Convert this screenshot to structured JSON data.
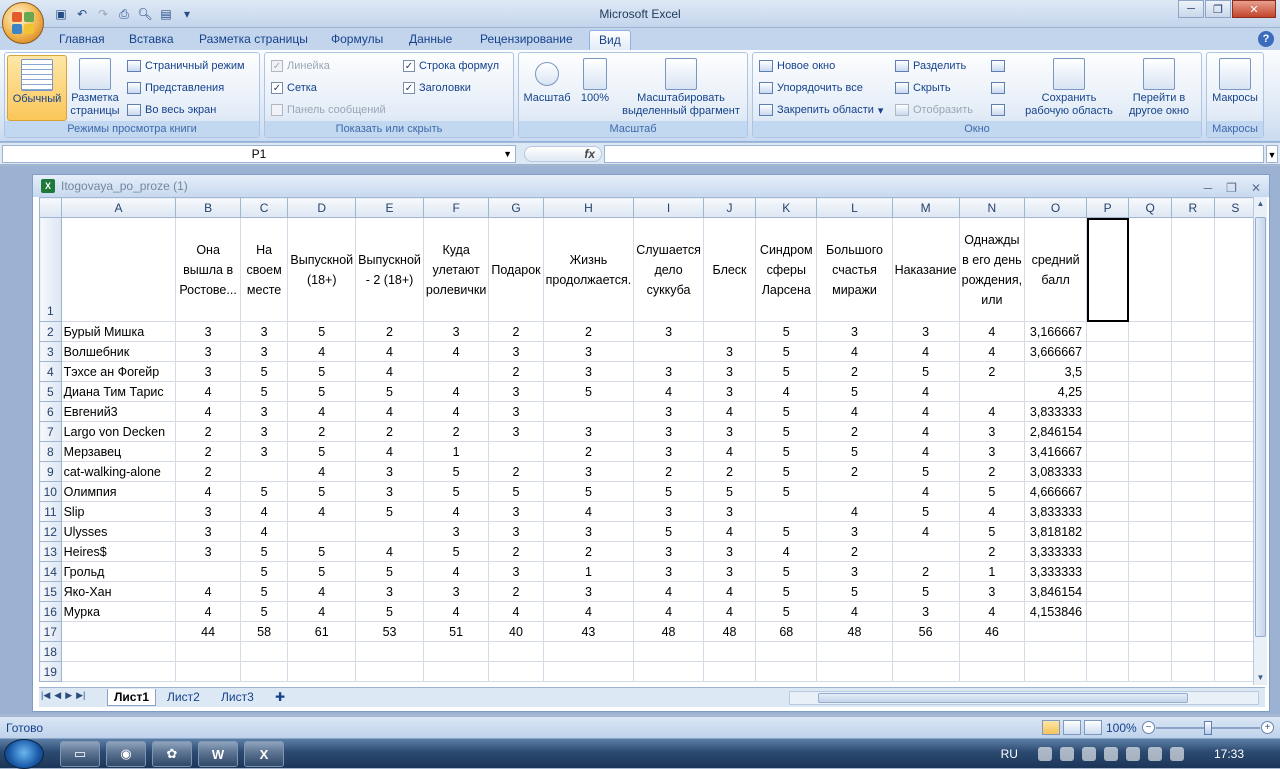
{
  "app_title": "Microsoft Excel",
  "window_controls": {
    "minimize": "─",
    "restore": "❐",
    "close": "✕"
  },
  "ribbon_tabs": [
    "Главная",
    "Вставка",
    "Разметка страницы",
    "Формулы",
    "Данные",
    "Рецензирование",
    "Вид"
  ],
  "active_tab": "Вид",
  "ribbon": {
    "views": {
      "label": "Режимы просмотра книги",
      "normal": "Обычный",
      "page_layout": "Разметка страницы",
      "page_break": "Страничный режим",
      "custom_views": "Представления",
      "full_screen": "Во весь экран"
    },
    "show_hide": {
      "label": "Показать или скрыть",
      "ruler": "Линейка",
      "gridlines": "Сетка",
      "message_bar": "Панель сообщений",
      "formula_bar": "Строка формул",
      "headings": "Заголовки"
    },
    "zoom": {
      "label": "Масштаб",
      "zoom": "Масштаб",
      "hundred": "100%",
      "zoom_selection": "Масштабировать выделенный фрагмент"
    },
    "window": {
      "label": "Окно",
      "new_window": "Новое окно",
      "arrange_all": "Упорядочить все",
      "freeze_panes": "Закрепить области",
      "split": "Разделить",
      "hide": "Скрыть",
      "unhide": "Отобразить",
      "save_workspace": "Сохранить рабочую область",
      "switch_windows": "Перейти в другое окно"
    },
    "macros": {
      "label": "Макросы",
      "macros": "Макросы"
    }
  },
  "name_box": "P1",
  "fx_label": "fx",
  "workbook_title": "Itogovaya_po_proze (1)",
  "columns": [
    "A",
    "B",
    "C",
    "D",
    "E",
    "F",
    "G",
    "H",
    "I",
    "J",
    "K",
    "L",
    "M",
    "N",
    "O",
    "P",
    "Q",
    "R",
    "S"
  ],
  "header_row": [
    "",
    "Она вышла в Ростове...",
    "На своем месте",
    "Выпускной (18+)",
    "Выпускной - 2 (18+)",
    "Куда улетают ролевички",
    "Подарок",
    "Жизнь продолжается.",
    "Слушается дело суккуба",
    "Блеск",
    "Синдром сферы Ларсена",
    "Большого счастья миражи",
    "Наказание",
    "Однажды в его день рождения, или",
    "средний балл",
    "",
    "",
    "",
    ""
  ],
  "rows": [
    {
      "n": "2",
      "cells": [
        "Бурый Мишка",
        "3",
        "3",
        "5",
        "2",
        "3",
        "2",
        "2",
        "3",
        "",
        "5",
        "3",
        "3",
        "4",
        "3,166667"
      ]
    },
    {
      "n": "3",
      "cells": [
        "Волшебник",
        "3",
        "3",
        "4",
        "4",
        "4",
        "3",
        "3",
        "",
        "3",
        "5",
        "4",
        "4",
        "4",
        "3,666667"
      ]
    },
    {
      "n": "4",
      "cells": [
        "Тэхсе ан Фогейр",
        "3",
        "5",
        "5",
        "4",
        "",
        "2",
        "3",
        "3",
        "3",
        "5",
        "2",
        "5",
        "2",
        "3,5"
      ]
    },
    {
      "n": "5",
      "cells": [
        "Диана Тим Тарис",
        "4",
        "5",
        "5",
        "5",
        "4",
        "3",
        "5",
        "4",
        "3",
        "4",
        "5",
        "4",
        "",
        "4,25"
      ]
    },
    {
      "n": "6",
      "cells": [
        "Евгений3",
        "4",
        "3",
        "4",
        "4",
        "4",
        "3",
        "",
        "3",
        "4",
        "5",
        "4",
        "4",
        "4",
        "3,833333"
      ]
    },
    {
      "n": "7",
      "cells": [
        "Largo von Decken",
        "2",
        "3",
        "2",
        "2",
        "2",
        "3",
        "3",
        "3",
        "3",
        "5",
        "2",
        "4",
        "3",
        "2,846154"
      ]
    },
    {
      "n": "8",
      "cells": [
        "Мерзавец",
        "2",
        "3",
        "5",
        "4",
        "1",
        "",
        "2",
        "3",
        "4",
        "5",
        "5",
        "4",
        "3",
        "3,416667"
      ]
    },
    {
      "n": "9",
      "cells": [
        "cat-walking-alone",
        "2",
        "",
        "4",
        "3",
        "5",
        "2",
        "3",
        "2",
        "2",
        "5",
        "2",
        "5",
        "2",
        "3,083333"
      ]
    },
    {
      "n": "10",
      "cells": [
        "Олимпия",
        "4",
        "5",
        "5",
        "3",
        "5",
        "5",
        "5",
        "5",
        "5",
        "5",
        "",
        "4",
        "5",
        "4,666667"
      ]
    },
    {
      "n": "11",
      "cells": [
        "Slip",
        "3",
        "4",
        "4",
        "5",
        "4",
        "3",
        "4",
        "3",
        "3",
        "",
        "4",
        "5",
        "4",
        "3,833333"
      ]
    },
    {
      "n": "12",
      "cells": [
        "Ulysses",
        "3",
        "4",
        "",
        "",
        "3",
        "3",
        "3",
        "5",
        "4",
        "5",
        "3",
        "4",
        "5",
        "3,818182"
      ]
    },
    {
      "n": "13",
      "cells": [
        "Heires$",
        "3",
        "5",
        "5",
        "4",
        "5",
        "2",
        "2",
        "3",
        "3",
        "4",
        "2",
        "",
        "2",
        "3,333333"
      ]
    },
    {
      "n": "14",
      "cells": [
        "Грольд",
        "",
        "5",
        "5",
        "5",
        "4",
        "3",
        "1",
        "3",
        "3",
        "5",
        "3",
        "2",
        "1",
        "3,333333"
      ]
    },
    {
      "n": "15",
      "cells": [
        "Яко-Хан",
        "4",
        "5",
        "4",
        "3",
        "3",
        "2",
        "3",
        "4",
        "4",
        "5",
        "5",
        "5",
        "3",
        "3,846154"
      ]
    },
    {
      "n": "16",
      "cells": [
        "Мурка",
        "4",
        "5",
        "4",
        "5",
        "4",
        "4",
        "4",
        "4",
        "4",
        "5",
        "4",
        "3",
        "4",
        "4,153846"
      ]
    },
    {
      "n": "17",
      "cells": [
        "",
        "44",
        "58",
        "61",
        "53",
        "51",
        "40",
        "43",
        "48",
        "48",
        "68",
        "48",
        "56",
        "46",
        ""
      ]
    },
    {
      "n": "18",
      "cells": [
        "",
        "",
        "",
        "",
        "",
        "",
        "",
        "",
        "",
        "",
        "",
        "",
        "",
        "",
        ""
      ]
    },
    {
      "n": "19",
      "cells": [
        "",
        "",
        "",
        "",
        "",
        "",
        "",
        "",
        "",
        "",
        "",
        "",
        "",
        "",
        ""
      ]
    }
  ],
  "sheet_tabs": [
    "Лист1",
    "Лист2",
    "Лист3"
  ],
  "active_sheet": "Лист1",
  "status": {
    "ready": "Готово",
    "zoom": "100%"
  },
  "taskbar": {
    "lang": "RU",
    "time": "17:33"
  }
}
